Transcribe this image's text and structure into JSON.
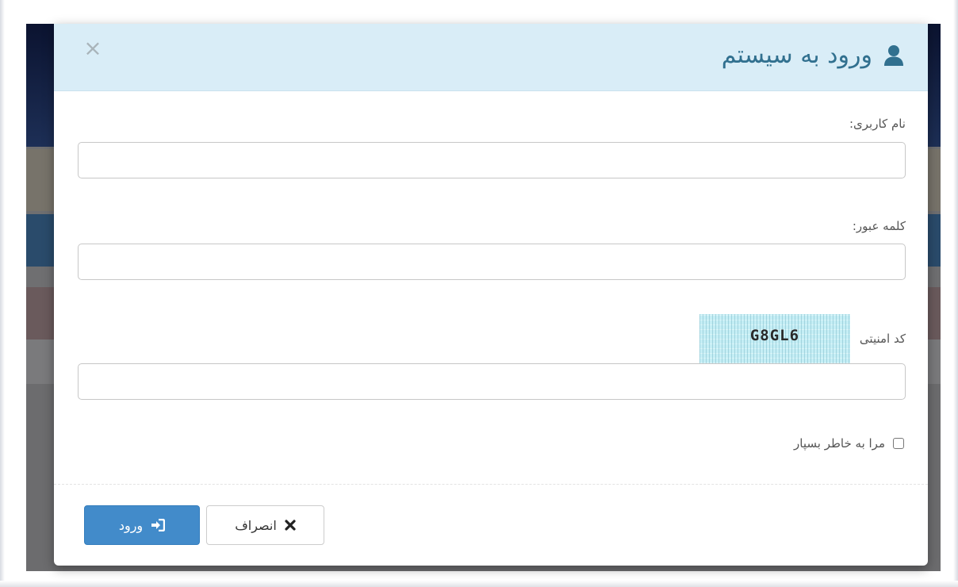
{
  "modal": {
    "title": "ورود به سیستم",
    "title_icon": "user-icon",
    "close_symbol": "×",
    "colors": {
      "header_bg": "#d9edf7",
      "title_color": "#31708f",
      "primary_button": "#428bca"
    }
  },
  "form": {
    "username": {
      "label": "نام کاربری:",
      "value": ""
    },
    "password": {
      "label": "کلمه عبور:",
      "value": ""
    },
    "captcha": {
      "label": "کد امنیتی",
      "code": "G8GL6",
      "value": ""
    },
    "remember": {
      "label": "مرا به خاطر بسپار",
      "checked": false
    }
  },
  "footer": {
    "login_label": "ورود",
    "login_icon": "sign-in-icon",
    "cancel_label": "انصراف",
    "cancel_icon": "times-icon"
  }
}
